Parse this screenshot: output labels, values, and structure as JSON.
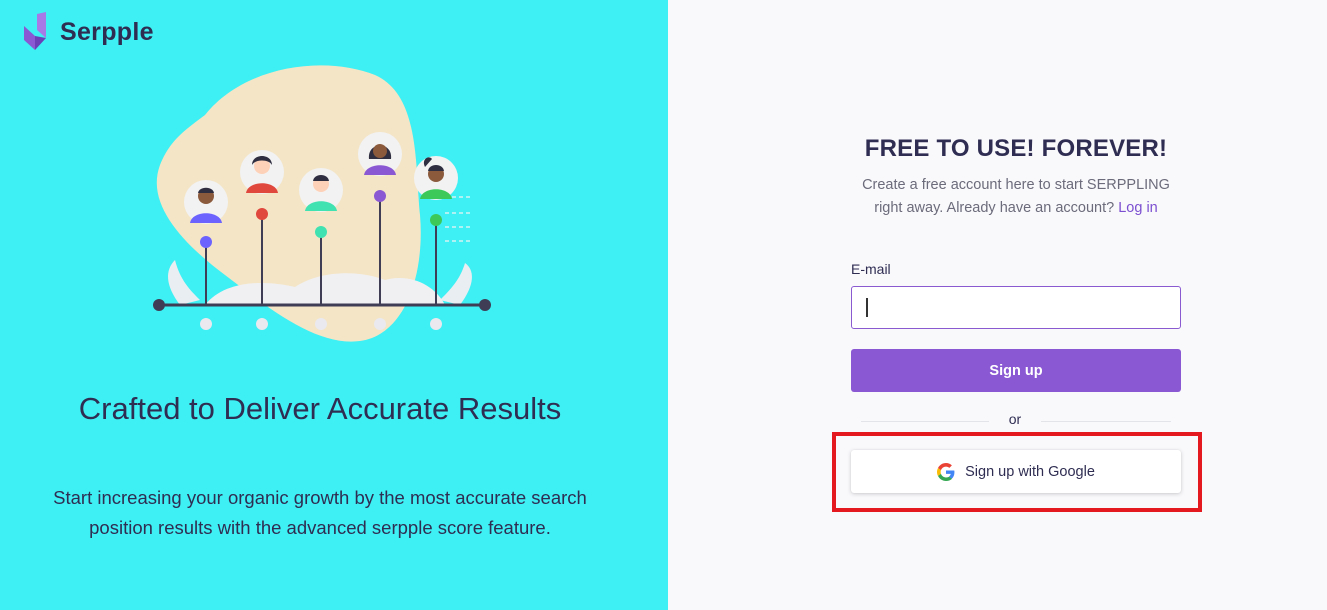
{
  "brand": {
    "name": "Serpple"
  },
  "hero": {
    "title": "Crafted to Deliver Accurate Results",
    "description": "Start increasing your organic growth by the most accurate search position results with the advanced serpple score feature."
  },
  "form": {
    "title": "FREE TO USE! FOREVER!",
    "subtitle": "Create a free account here to start SERPPLING right away. Already have an account?",
    "login_link": "Log in",
    "email_label": "E-mail",
    "email_value": "",
    "signup_label": "Sign up",
    "divider_text": "or",
    "google_label": "Sign up with Google"
  },
  "colors": {
    "left_bg": "#3ef0f3",
    "accent": "#8a58d2",
    "text_dark": "#2f2d52",
    "highlight": "#e3191f"
  },
  "icons": {
    "logo": "serpple-logo-icon",
    "google": "google-icon"
  }
}
